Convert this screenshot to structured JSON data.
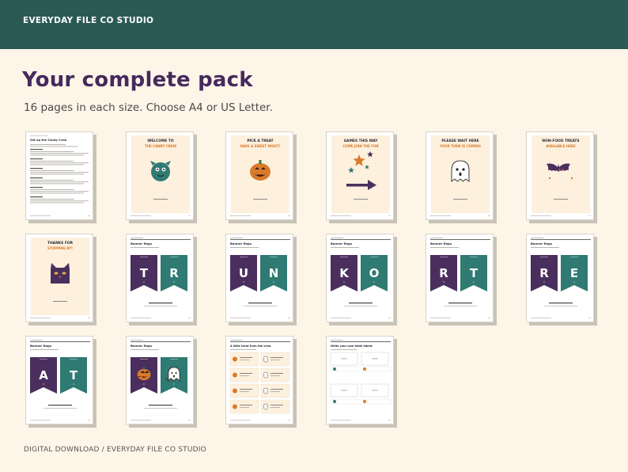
{
  "header": {
    "brand": "EVERYDAY FILE CO STUDIO"
  },
  "main": {
    "title": "Your complete pack",
    "subtitle": "16 pages in each size. Choose A4 or US Letter."
  },
  "footer": {
    "text": "DIGITAL DOWNLOAD / EVERYDAY FILE CO STUDIO"
  },
  "colors": {
    "header_bg": "#2b5a55",
    "title": "#46295c",
    "purple": "#4a2f5e",
    "teal": "#2f7a72",
    "orange": "#d97a2b",
    "page_bg": "#fdf5e8"
  },
  "pages": [
    {
      "kind": "instructions",
      "heading": "Set up the Candy Crew"
    },
    {
      "kind": "sign",
      "line1": "WELCOME TO",
      "line2": "THE CANDY CREW",
      "icon": "monster-icon"
    },
    {
      "kind": "sign",
      "line1": "PICK A TREAT",
      "line2": "HAVE A SWEET NIGHT!",
      "icon": "pumpkin-icon"
    },
    {
      "kind": "sign",
      "line1": "GAMES THIS WAY",
      "line2": "COME JOIN THE FUN",
      "icon": "stars-arrow-icon"
    },
    {
      "kind": "sign",
      "line1": "PLEASE WAIT HERE",
      "line2": "YOUR TURN IS COMING",
      "icon": "ghost-icon"
    },
    {
      "kind": "sign",
      "line1": "NON-FOOD TREATS",
      "line2": "AVAILABLE HERE",
      "icon": "bat-icon"
    },
    {
      "kind": "sign",
      "line1": "THANKS FOR",
      "line2": "STOPPING BY!",
      "icon": "cat-icon"
    },
    {
      "kind": "banner",
      "heading": "Banner flags",
      "flags": [
        "T",
        "R"
      ]
    },
    {
      "kind": "banner",
      "heading": "Banner flags",
      "flags": [
        "U",
        "N"
      ]
    },
    {
      "kind": "banner",
      "heading": "Banner flags",
      "flags": [
        "K",
        "O"
      ]
    },
    {
      "kind": "banner",
      "heading": "Banner flags",
      "flags": [
        "R",
        "T"
      ]
    },
    {
      "kind": "banner",
      "heading": "Banner flags",
      "flags": [
        "R",
        "E"
      ]
    },
    {
      "kind": "banner",
      "heading": "Banner flags",
      "flags": [
        "A",
        "T"
      ]
    },
    {
      "kind": "banner",
      "heading": "Banner flags",
      "flags": [
        "pumpkin-icon",
        "ghost-icon"
      ]
    },
    {
      "kind": "labels",
      "heading": "A little treat from the crew"
    },
    {
      "kind": "tablelabels",
      "heading": "Write your own table labels"
    }
  ]
}
